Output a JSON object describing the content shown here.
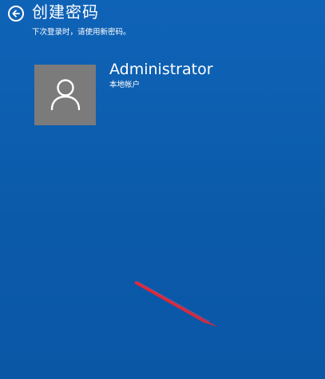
{
  "header": {
    "back_icon": "circle-arrow-left-icon",
    "title": "创建密码",
    "subtitle": "下次登录时，请使用新密码。"
  },
  "account": {
    "avatar_icon": "user-silhouette-icon",
    "name": "Administrator",
    "type": "本地帐户"
  },
  "colors": {
    "background": "#0d5fb0",
    "avatar_tile": "#7b7b7b",
    "annotation_arrow": "#e0283a"
  }
}
